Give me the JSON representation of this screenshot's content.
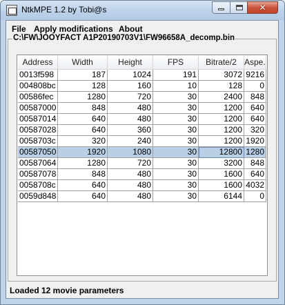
{
  "window": {
    "title": "NtkMPE 1.2 by Tobi@s",
    "close_glyph": "✕"
  },
  "menu": [
    "File",
    "Apply modifications",
    "About"
  ],
  "group": {
    "path": "C:\\FW\\JOOYFACT A1P20190703V1\\FW96658A_decomp.bin"
  },
  "table": {
    "columns": [
      "Address",
      "Width",
      "Height",
      "FPS",
      "Bitrate/2",
      "Aspe..."
    ],
    "rows": [
      [
        "0013f598",
        "187",
        "1024",
        "191",
        "3072",
        "9216"
      ],
      [
        "004808bc",
        "128",
        "160",
        "10",
        "128",
        "0"
      ],
      [
        "00586fec",
        "1280",
        "720",
        "30",
        "2400",
        "848"
      ],
      [
        "00587000",
        "848",
        "480",
        "30",
        "1200",
        "640"
      ],
      [
        "00587014",
        "640",
        "480",
        "30",
        "1200",
        "640"
      ],
      [
        "00587028",
        "640",
        "360",
        "30",
        "1200",
        "320"
      ],
      [
        "0058703c",
        "320",
        "240",
        "30",
        "1200",
        "1920"
      ],
      [
        "00587050",
        "1920",
        "1080",
        "30",
        "12800",
        "1280"
      ],
      [
        "00587064",
        "1280",
        "720",
        "30",
        "3200",
        "848"
      ],
      [
        "00587078",
        "848",
        "480",
        "30",
        "1600",
        "640"
      ],
      [
        "0058708c",
        "640",
        "480",
        "30",
        "1600",
        "4032"
      ],
      [
        "0059d848",
        "640",
        "480",
        "30",
        "6144",
        "0"
      ]
    ],
    "selected_row": 7,
    "focused_column": 4
  },
  "status": "Loaded 12 movie parameters",
  "colors": {
    "selection": "#b8cfe5",
    "titlebar": "#bcd1ea",
    "close": "#c9543b"
  }
}
